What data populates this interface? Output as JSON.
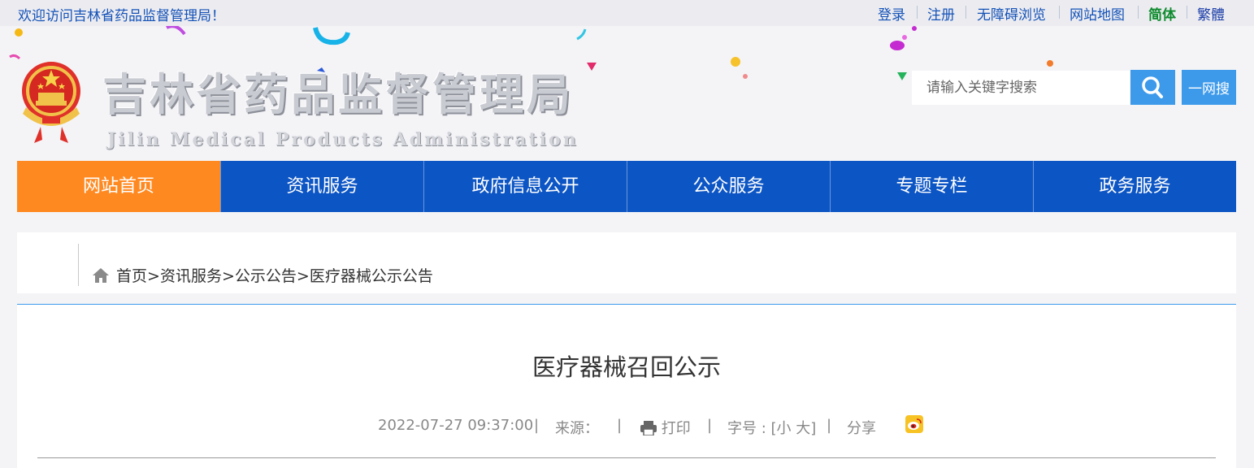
{
  "topbar": {
    "welcome": "欢迎访问吉林省药品监督管理局！",
    "links": {
      "login": "登录",
      "register": "注册",
      "accessible": "无障碍浏览",
      "sitemap": "网站地图",
      "simplified": "简体",
      "traditional": "繁體"
    }
  },
  "header": {
    "logo_cn": "吉林省药品监督管理局",
    "logo_en": "Jilin Medical Products Administration",
    "search": {
      "placeholder": "请输入关键字搜索",
      "button_icon": "search-icon",
      "yiwang_label": "一网搜"
    }
  },
  "nav": {
    "items": [
      "网站首页",
      "资讯服务",
      "政府信息公开",
      "公众服务",
      "专题专栏",
      "政务服务"
    ],
    "active_index": 0
  },
  "breadcrumb": {
    "home": "首页",
    "sep": ">",
    "level1": "资讯服务",
    "level2": "公示公告",
    "level3": "医疗器械公示公告"
  },
  "article": {
    "title": "医疗器械召回公示",
    "datetime": "2022-07-27 09:37:00",
    "source_label": "来源：",
    "print_label": "打印",
    "font_label": "字号 : [小 大]",
    "share_label": "分享",
    "divider": "|",
    "share_icon": "weibo-icon"
  },
  "colors": {
    "nav_blue": "#0c55c5",
    "nav_home": "#ff8921",
    "search_blue": "#3d9aeb",
    "link_blue": "#1452b8",
    "active_green": "#0d8a2d"
  }
}
